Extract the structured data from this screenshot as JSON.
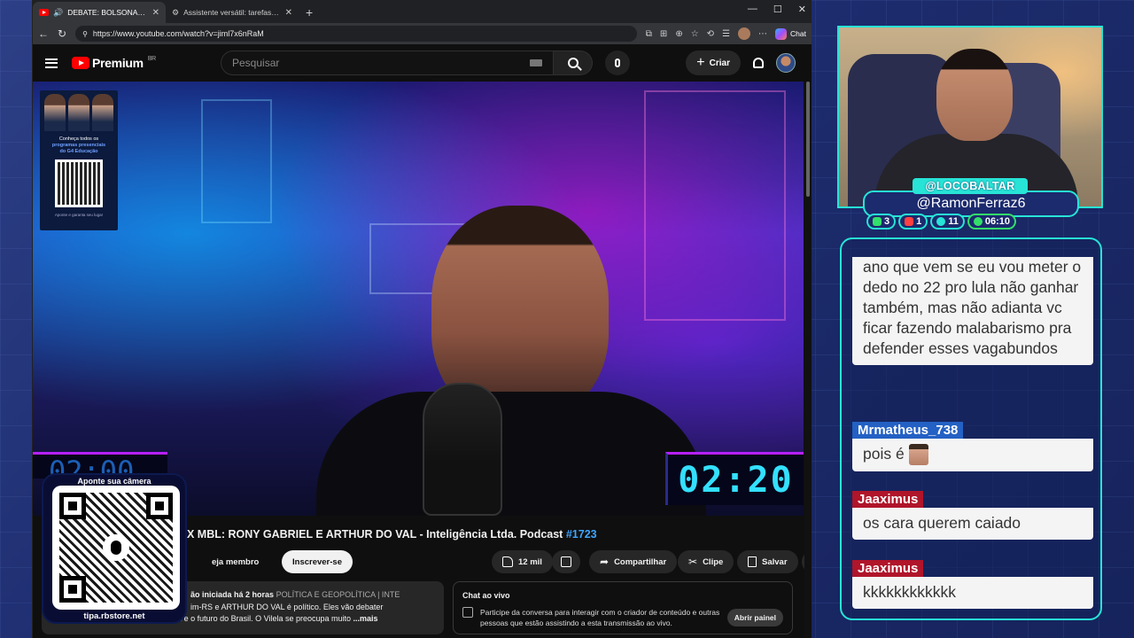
{
  "browser": {
    "tabs": [
      {
        "title": "DEBATE: BOLSONARISTA X MBL: RONY GABRIEL E ARTHUR DO VAL",
        "active": true
      },
      {
        "title": "Assistente versátil: tarefas, respostas",
        "active": false
      }
    ],
    "url": "https://www.youtube.com/watch?v=jiml7x6nRaM",
    "chat_label": "Chat"
  },
  "youtube": {
    "logo_text": "Premium",
    "region": "BR",
    "search_placeholder": "Pesquisar",
    "create_label": "Criar"
  },
  "video": {
    "timer_right": "02:20",
    "timer_left": "02:00",
    "promo": {
      "line1": "Conheça todos os",
      "line2": "programas presenciais",
      "line3": "do G4 Educação",
      "footer": "Aponte e garanta seu lugar"
    },
    "title_prefix": "X MBL: RONY GABRIEL E ARTHUR DO VAL - Inteligência Ltda. Podcast",
    "title_hashtag": "#1723"
  },
  "actions": {
    "member_label": "eja membro",
    "subscribe_label": "Inscrever-se",
    "likes": "12 mil",
    "share_label": "Compartilhar",
    "clip_label": "Clipe",
    "save_label": "Salvar"
  },
  "description": {
    "meta": "ão iniciada há 2 horas",
    "category": "POLÍTICA E GEOPOLÍTICA | INTE",
    "line2": "im-RS e ARTHUR DO VAL é político. Eles vão debater",
    "line3": "sobre Bolsonaro, a política de direita e o futuro do Brasil. O Vilela se preocupa muito",
    "more": "...mais"
  },
  "live_chat": {
    "title": "Chat ao vivo",
    "text": "Participe da conversa para interagir com o criador de conteúdo e outras pessoas que estão assistindo a esta transmissão ao vivo.",
    "button": "Abrir painel"
  },
  "qr_overlay": {
    "top_text": "Aponte sua câmera",
    "bottom_text": "tipa.rbstore.net"
  },
  "stream": {
    "handle_top": "@LOCOBALTAR",
    "handle_main": "@RamonFerraz6",
    "stats": [
      {
        "icon": "chat-icon",
        "value": "3"
      },
      {
        "icon": "youtube-icon",
        "value": "1"
      },
      {
        "icon": "viewers-icon",
        "value": "11"
      },
      {
        "icon": "clock-icon",
        "value": "06:10"
      }
    ]
  },
  "chat_messages": [
    {
      "user": "",
      "text": "ano que vem se eu vou meter o dedo no 22 pro lula não ganhar também, mas não adianta vc ficar fazendo malabarismo pra defender esses vagabundos"
    },
    {
      "user": "Mrmatheus_738",
      "text": "pois é",
      "user_color": "#2361c4"
    },
    {
      "user": "Jaaximus",
      "text": "os cara querem caiado",
      "user_color": "#b0152a"
    },
    {
      "user": "Jaaximus",
      "text": "kkkkkkkkkkkk",
      "user_color": "#b0152a"
    }
  ]
}
